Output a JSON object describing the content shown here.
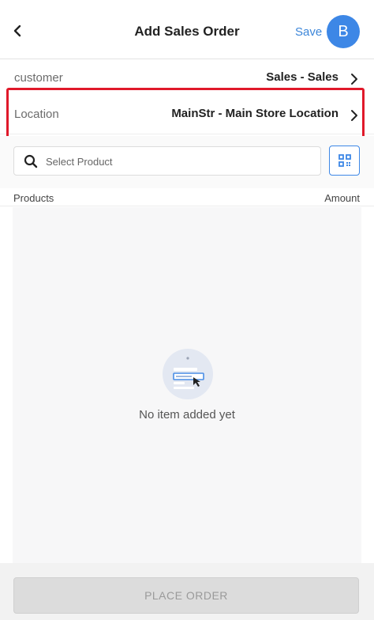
{
  "header": {
    "title": "Add Sales Order",
    "save_label": "Save",
    "avatar_initial": "B",
    "back_icon": "chevron-left-icon"
  },
  "customer": {
    "label": "customer",
    "value": "Sales - Sales",
    "icon": "chevron-right-icon"
  },
  "location": {
    "label": "Location",
    "value": "MainStr - Main Store Location",
    "icon": "chevron-right-icon"
  },
  "search": {
    "placeholder": "Select Product",
    "icon": "search-icon",
    "scan_icon": "qr-code-icon"
  },
  "columns": {
    "products": "Products",
    "amount": "Amount"
  },
  "empty_state": {
    "message": "No item added yet",
    "icon": "empty-list-icon"
  },
  "footer": {
    "place_order_label": "PLACE ORDER"
  },
  "colors": {
    "accent": "#3d87e6",
    "highlight": "#e0192a",
    "disabled_button": "#dcdcdc"
  }
}
